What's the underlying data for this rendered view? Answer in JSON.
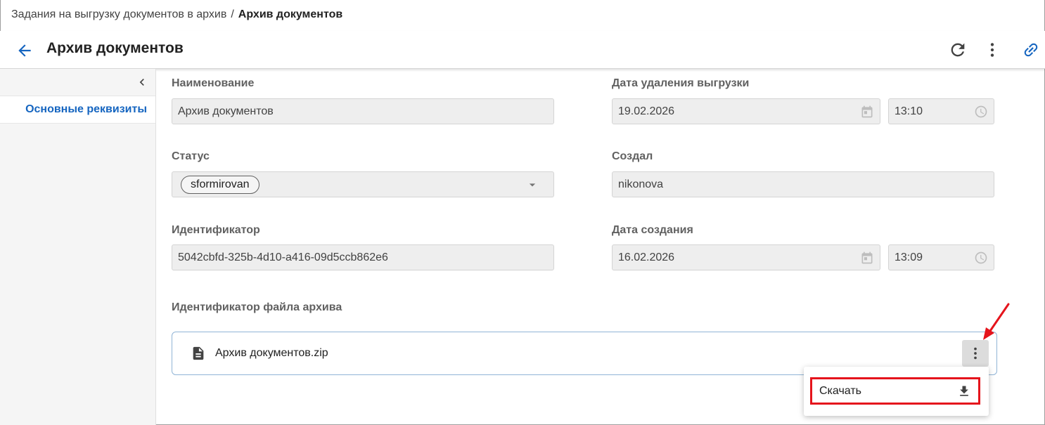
{
  "breadcrumb": {
    "parent": "Задания на выгрузку документов в архив",
    "separator": "/",
    "current": "Архив документов"
  },
  "header": {
    "title": "Архив документов",
    "icons": [
      "arrow-back-icon",
      "refresh-icon",
      "more-vert-icon",
      "link-icon"
    ]
  },
  "sidebar": {
    "items": [
      {
        "label": "Основные реквизиты",
        "active": true
      }
    ]
  },
  "form": {
    "name": {
      "label": "Наименование",
      "value": "Архив документов"
    },
    "status": {
      "label": "Статус",
      "value": "sformirovan"
    },
    "identifier": {
      "label": "Идентификатор",
      "value": "5042cbfd-325b-4d10-a416-09d5ccb862e6"
    },
    "delete_date": {
      "label": "Дата удаления выгрузки",
      "date": "19.02.2026",
      "time": "13:10"
    },
    "created_by": {
      "label": "Создал",
      "value": "nikonova"
    },
    "created_date": {
      "label": "Дата создания",
      "date": "16.02.2026",
      "time": "13:09"
    },
    "archive_file": {
      "label": "Идентификатор файла архива",
      "file_name": "Архив документов.zip"
    }
  },
  "context_menu": {
    "items": [
      {
        "label": "Скачать",
        "icon": "download-icon"
      }
    ]
  },
  "colors": {
    "accent": "#1565c0",
    "highlight": "#e5141c",
    "field_bg": "#eeeeee"
  }
}
